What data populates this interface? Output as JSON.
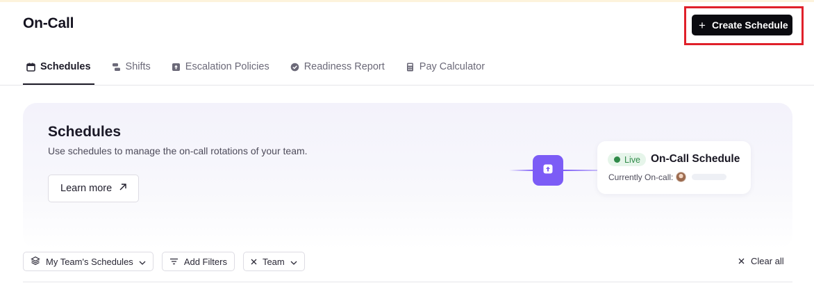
{
  "page": {
    "title": "On-Call"
  },
  "header": {
    "create_label": "Create Schedule"
  },
  "tabs": [
    {
      "label": "Schedules",
      "icon": "calendar-icon",
      "active": true
    },
    {
      "label": "Shifts",
      "icon": "shifts-icon",
      "active": false
    },
    {
      "label": "Escalation Policies",
      "icon": "escalation-icon",
      "active": false
    },
    {
      "label": "Readiness Report",
      "icon": "check-badge-icon",
      "active": false
    },
    {
      "label": "Pay Calculator",
      "icon": "calculator-icon",
      "active": false
    }
  ],
  "hero": {
    "title": "Schedules",
    "description": "Use schedules to manage the on-call rotations of your team.",
    "learn_more_label": "Learn more",
    "card": {
      "badge": "Live",
      "title": "On-Call Schedule",
      "currently_label": "Currently On-call:"
    }
  },
  "filters": {
    "my_team_label": "My Team's Schedules",
    "add_filters_label": "Add Filters",
    "team_label": "Team",
    "clear_all_label": "Clear all"
  },
  "colors": {
    "accent": "#7c5cf6",
    "primary_button": "#0b0b10",
    "live_green": "#2f8a48",
    "highlight_red": "#e0202a"
  }
}
